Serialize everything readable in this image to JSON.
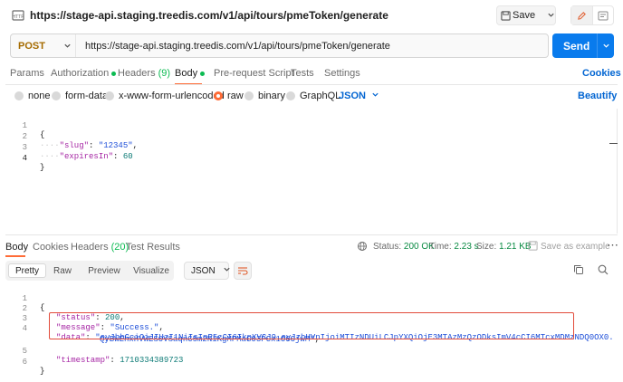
{
  "request": {
    "title": "https://stage-api.staging.treedis.com/v1/api/tours/pmeToken/generate",
    "method": "POST",
    "url": "https://stage-api.staging.treedis.com/v1/api/tours/pmeToken/generate",
    "save_label": "Save",
    "send_label": "Send"
  },
  "request_tabs": {
    "params": "Params",
    "authorization": "Authorization",
    "headers": "Headers",
    "headers_count": "(9)",
    "body": "Body",
    "prerequest": "Pre-request Script",
    "tests": "Tests",
    "settings": "Settings",
    "cookies": "Cookies"
  },
  "body_options": {
    "none": "none",
    "form_data": "form-data",
    "urlencoded": "x-www-form-urlencoded",
    "raw": "raw",
    "binary": "binary",
    "graphql": "GraphQL",
    "format": "JSON",
    "beautify": "Beautify"
  },
  "request_body": {
    "line_numbers": [
      "1",
      "2",
      "3",
      "4"
    ],
    "open": "{",
    "slug_key": "\"slug\"",
    "slug_value": "\"12345\"",
    "expires_key": "\"expiresIn\"",
    "expires_value": "60",
    "close": "}"
  },
  "response_tabs": {
    "body": "Body",
    "cookies": "Cookies",
    "headers": "Headers",
    "headers_count": "(20)",
    "test_results": "Test Results",
    "status_label": "Status:",
    "status_value": "200 OK",
    "time_label": "Time:",
    "time_value": "2.23 s",
    "size_label": "Size:",
    "size_value": "1.21 KB",
    "save_example": "Save as example"
  },
  "response_toolbar": {
    "pretty": "Pretty",
    "raw": "Raw",
    "preview": "Preview",
    "visualize": "Visualize",
    "format": "JSON"
  },
  "response_body": {
    "line_numbers": [
      "1",
      "2",
      "3",
      "4",
      "5",
      "6"
    ],
    "open": "{",
    "status_key": "\"status\"",
    "status_value": "200",
    "message_key": "\"message\"",
    "message_value": "\"Success.\"",
    "data_key": "\"data\"",
    "data_value_line1": "\"eyJhbGciOiJIUzI1NiIsInR5cCI6IkpXVCJ9.eyJzbHVnIjoiMTIzNDUiLCJpYXQiOjE3MTAzMzQzODksImV4cCI6MTcxMDMzNDQ0OX0.",
    "data_value_line2": "QyBWEhxHVWES0VSaqnC5m2NiKgMPMaG03PCx1O6OjwM\"",
    "timestamp_key": "\"timestamp\"",
    "timestamp_value": "1710334389723",
    "close": "}"
  },
  "colors": {
    "accent": "#ff6c37",
    "send": "#097bed",
    "method": "#a56b00",
    "status_ok": "#0a8a43",
    "highlight": "#e24b3b"
  }
}
